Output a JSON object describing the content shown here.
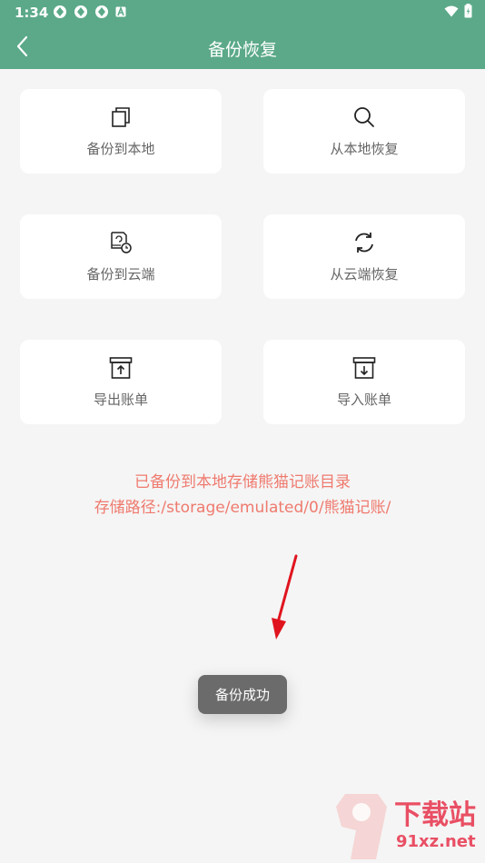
{
  "status_bar": {
    "time": "1:34"
  },
  "toolbar": {
    "title": "备份恢复"
  },
  "actions": [
    {
      "label": "备份到本地",
      "icon": "copy-icon"
    },
    {
      "label": "从本地恢复",
      "icon": "search-icon"
    },
    {
      "label": "备份到云端",
      "icon": "cloud-backup-icon"
    },
    {
      "label": "从云端恢复",
      "icon": "sync-icon"
    },
    {
      "label": "导出账单",
      "icon": "export-box-icon"
    },
    {
      "label": "导入账单",
      "icon": "import-box-icon"
    }
  ],
  "info": {
    "line1": "已备份到本地存储熊猫记账目录",
    "line2": "存储路径:/storage/emulated/0/熊猫记账/"
  },
  "toast": {
    "text": "备份成功"
  },
  "watermark": {
    "brand": "下载站",
    "domain": "91xz.net",
    "logo": "9"
  },
  "colors": {
    "header": "#5ba989",
    "info_text": "#ef7a6e",
    "toast_bg": "#6b6b6b",
    "arrow": "#e0141e"
  }
}
